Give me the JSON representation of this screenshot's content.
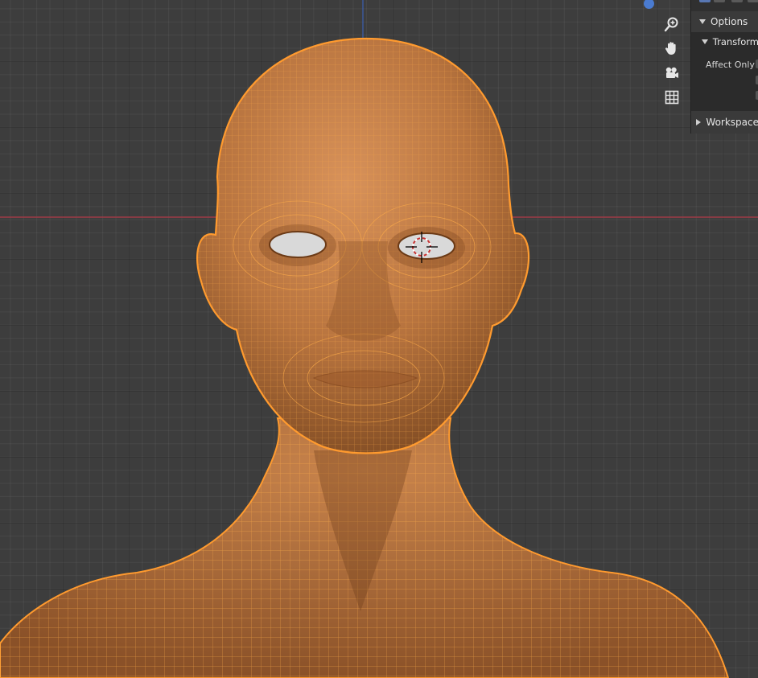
{
  "app": "Blender",
  "viewport": {
    "background_color": "#3d3d3d",
    "x_axis_color": "#a03b47",
    "y_axis_color": "#3b5fb0",
    "model": "head-and-shoulders mesh in edit/selected wireframe overlay",
    "model_color": "#c07a3f",
    "wire_color": "#ff9a2e"
  },
  "navigation": {
    "buttons": [
      {
        "name": "zoom-icon"
      },
      {
        "name": "pan-hand-icon"
      },
      {
        "name": "camera-view-icon"
      },
      {
        "name": "orthographic-grid-icon"
      }
    ]
  },
  "sidebar": {
    "options_label": "Options",
    "transform_label": "Transform",
    "affect_only_label": "Affect Only",
    "workspace_label": "Workspace"
  }
}
